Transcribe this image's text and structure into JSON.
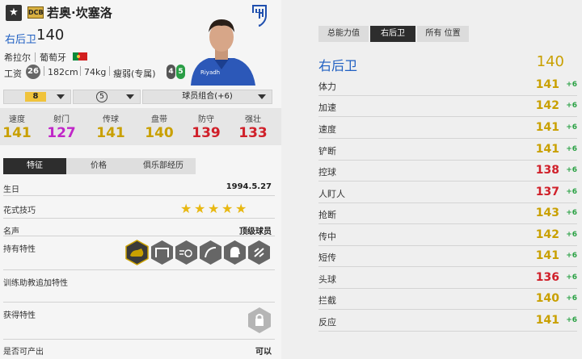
{
  "header": {
    "star_glyph": "★",
    "badge": "DCB",
    "player_name": "若奥·坎塞洛",
    "position": "右后卫",
    "overall": "140",
    "team": "希拉尔",
    "nation": "葡萄牙",
    "salary_label": "工资",
    "salary": "26",
    "height": "182cm",
    "weight": "74kg",
    "build": "瘦弱(专属)",
    "weak_foot": "4",
    "strong_foot": "5"
  },
  "selectors": {
    "level": "8",
    "rank": "5",
    "combo": "球员组合(+6)"
  },
  "stats": [
    {
      "label": "速度",
      "value": "141",
      "color": "#c9a000"
    },
    {
      "label": "射门",
      "value": "127",
      "color": "#c026c8"
    },
    {
      "label": "传球",
      "value": "141",
      "color": "#c9a000"
    },
    {
      "label": "盘带",
      "value": "140",
      "color": "#c9a000"
    },
    {
      "label": "防守",
      "value": "139",
      "color": "#d0202a"
    },
    {
      "label": "强壮",
      "value": "133",
      "color": "#d0202a"
    }
  ],
  "tabs": [
    "特征",
    "价格",
    "俱乐部经历"
  ],
  "info": {
    "birthday_label": "生日",
    "birthday": "1994.5.27",
    "skill_label": "花式技巧",
    "skill_stars": [
      "★",
      "★",
      "★",
      "★",
      "★"
    ],
    "fame_label": "名声",
    "fame": "顶级球员",
    "traits_label": "持有特性",
    "coach_label": "训练助教追加特性",
    "acquire_label": "获得特性",
    "tradable_label": "是否可产出",
    "tradable": "可以"
  },
  "right_tabs": [
    "总能力值",
    "右后卫",
    "所有 位置"
  ],
  "right_header": {
    "position": "右后卫",
    "value": "140"
  },
  "attributes": [
    {
      "name": "体力",
      "value": "141",
      "bonus": "+6",
      "color": "#c9a000"
    },
    {
      "name": "加速",
      "value": "142",
      "bonus": "+6",
      "color": "#c9a000"
    },
    {
      "name": "速度",
      "value": "141",
      "bonus": "+6",
      "color": "#c9a000"
    },
    {
      "name": "铲断",
      "value": "141",
      "bonus": "+6",
      "color": "#c9a000"
    },
    {
      "name": "控球",
      "value": "138",
      "bonus": "+6",
      "color": "#d0202a"
    },
    {
      "name": "人盯人",
      "value": "137",
      "bonus": "+6",
      "color": "#d0202a"
    },
    {
      "name": "抢断",
      "value": "143",
      "bonus": "+6",
      "color": "#c9a000"
    },
    {
      "name": "传中",
      "value": "142",
      "bonus": "+6",
      "color": "#c9a000"
    },
    {
      "name": "短传",
      "value": "141",
      "bonus": "+6",
      "color": "#c9a000"
    },
    {
      "name": "头球",
      "value": "136",
      "bonus": "+6",
      "color": "#d0202a"
    },
    {
      "name": "拦截",
      "value": "140",
      "bonus": "+6",
      "color": "#c9a000"
    },
    {
      "name": "反应",
      "value": "141",
      "bonus": "+6",
      "color": "#c9a000"
    }
  ],
  "colors": {
    "accent": "#1f5fc2",
    "gold": "#c9a000",
    "red": "#d0202a",
    "bonus": "#2aa144"
  }
}
